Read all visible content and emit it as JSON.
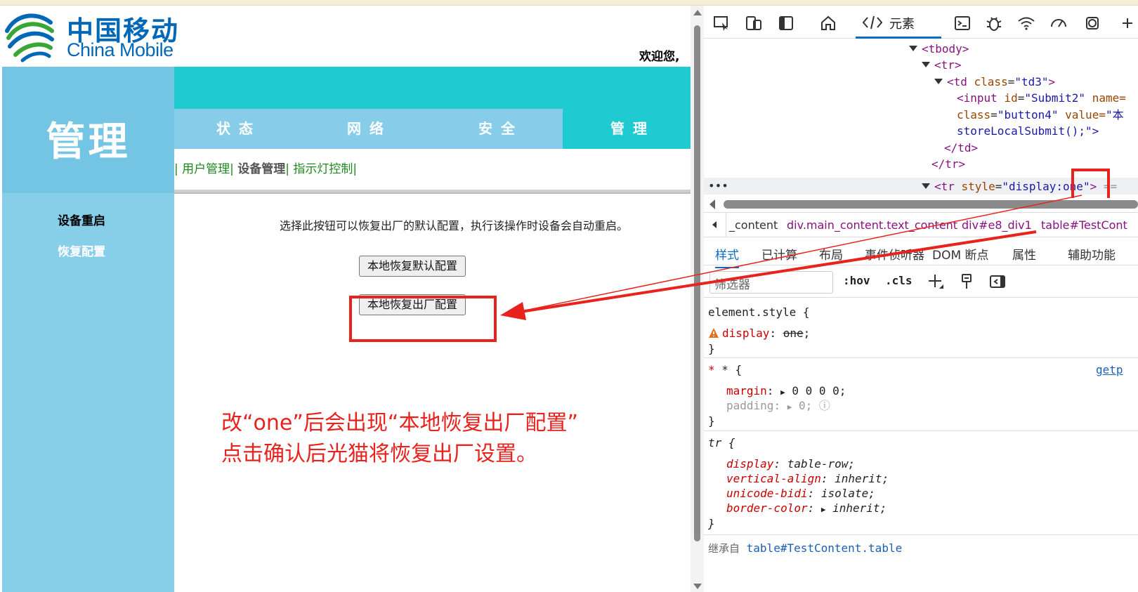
{
  "page": {
    "brand": {
      "cn": "中国移动",
      "en": "China Mobile"
    },
    "welcome": "欢迎您,",
    "left_title": "管理",
    "side_menu": [
      {
        "label": "设备重启"
      },
      {
        "label": "恢复配置"
      }
    ],
    "tabs": [
      {
        "label": "状态"
      },
      {
        "label": "网络"
      },
      {
        "label": "安全"
      },
      {
        "label": "管理"
      }
    ],
    "subnav": {
      "sep": "|",
      "items": [
        "用户管理",
        "设备管理",
        "指示灯控制"
      ]
    },
    "description": "选择此按钮可以恢复出厂的默认配置，执行该操作时设备会自动重启。",
    "buttons": {
      "restore_default": "本地恢复默认配置",
      "restore_factory": "本地恢复出厂配置"
    },
    "annotation": {
      "line1": "改“one”后会出现“本地恢复出厂配置”",
      "line2": "点击确认后光猫将恢复出厂设置。"
    }
  },
  "devtools": {
    "active_tab": "元素",
    "dom_lines": [
      {
        "tag": "<tbody>"
      },
      {
        "tag": "<tr>"
      },
      {
        "open": "<td ",
        "attr": "class",
        "val": "\"td3\"",
        "close": ">"
      },
      {
        "open": "<input ",
        "attr": "id",
        "val": "\"Submit2\"",
        "attr2": "name=",
        "val2": ""
      },
      {
        "attr": "class",
        "val": "\"button4\"",
        "attr2": "value=",
        "val2": "\"本"
      },
      {
        "text": "storeLocalSubmit();\">"
      },
      {
        "tag": "</td>"
      },
      {
        "tag": "</tr>"
      },
      {
        "open": "<tr ",
        "attr": "style",
        "val": "\"display:one\"",
        "close": ">",
        "tail": "=="
      }
    ],
    "breadcrumbs": [
      "_content",
      "div.main_content.text_content",
      "div#e8_div1",
      "table#TestCont"
    ],
    "panel_tabs": [
      "样式",
      "已计算",
      "布局",
      "事件侦听器",
      "DOM 断点",
      "属性",
      "辅助功能"
    ],
    "filter_placeholder": "筛选器",
    "filter_tools": {
      "hov": ":hov",
      "cls": ".cls"
    },
    "styles": {
      "element_style": "element.style {",
      "element_prop": "display",
      "element_val": "one",
      "universal_sel": "* {",
      "universal_src": "getp",
      "margin_prop": "margin",
      "margin_val": "0 0 0 0",
      "padding_prop": "padding",
      "padding_val": "0",
      "tr_sel": "tr {",
      "tr_props": [
        {
          "p": "display",
          "v": "table-row"
        },
        {
          "p": "vertical-align",
          "v": "inherit"
        },
        {
          "p": "unicode-bidi",
          "v": "isolate"
        },
        {
          "p": "border-color",
          "v": "inherit"
        }
      ],
      "close_brace": "}",
      "inherited_label": "继承自",
      "inherited_from": "table#TestContent.table"
    }
  },
  "colors": {
    "brand_blue": "#0068b7",
    "teal": "#1fcad0",
    "sky": "#87cde9",
    "annotation_red": "#e8231d",
    "devtools_accent": "#0a6cc9"
  }
}
